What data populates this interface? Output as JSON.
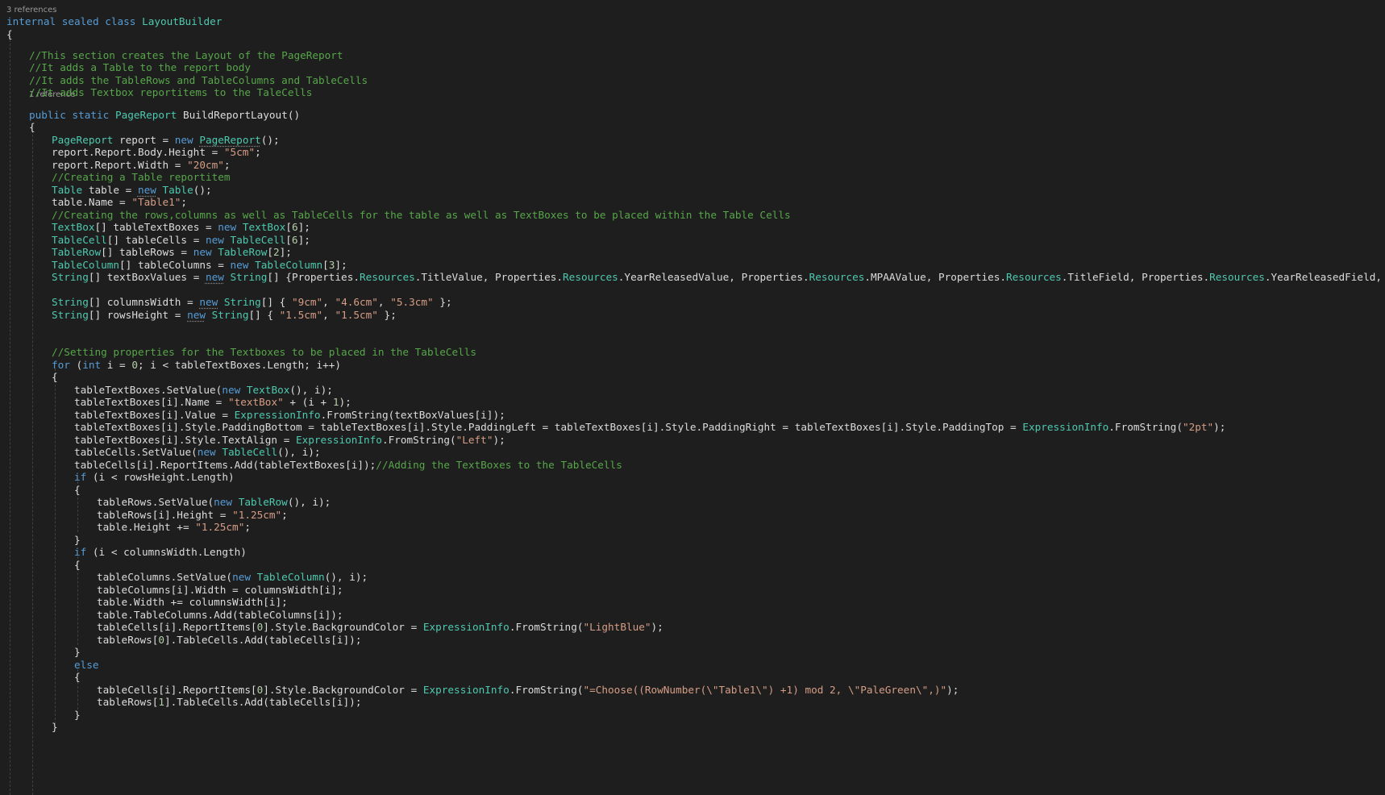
{
  "editor": {
    "codelens": {
      "class_refs": "3 references",
      "method_refs": "1 reference"
    },
    "lines": [
      [
        [
          "kw",
          "internal sealed class "
        ],
        [
          "ty",
          "LayoutBuilder"
        ]
      ],
      [
        [
          "pl",
          "{"
        ]
      ],
      [
        [
          "cm",
          "//This section creates the Layout of the PageReport"
        ]
      ],
      [
        [
          "cm",
          "//It adds a Table to the report body"
        ]
      ],
      [
        [
          "cm",
          "//It adds the TableRows and TableColumns and TableCells"
        ]
      ],
      [
        [
          "cm",
          "//It adds Textbox reportitems to the TaleCells"
        ]
      ],
      [
        [
          "kw",
          "public static "
        ],
        [
          "ty",
          "PageReport"
        ],
        [
          "pl",
          " BuildReportLayout()"
        ]
      ],
      [
        [
          "pl",
          "{"
        ]
      ],
      [
        [
          "ty",
          "PageReport"
        ],
        [
          "pl",
          " report = "
        ],
        [
          "kw",
          "new "
        ],
        [
          "tysq",
          "PageReport"
        ],
        [
          "pl",
          "();"
        ]
      ],
      [
        [
          "pl",
          "report.Report.Body.Height = "
        ],
        [
          "st",
          "\"5cm\""
        ],
        [
          "pl",
          ";"
        ]
      ],
      [
        [
          "pl",
          "report.Report.Width = "
        ],
        [
          "st",
          "\"20cm\""
        ],
        [
          "pl",
          ";"
        ]
      ],
      [
        [
          "cm",
          "//Creating a Table reportitem"
        ]
      ],
      [
        [
          "ty",
          "Table"
        ],
        [
          "pl",
          " table = "
        ],
        [
          "kwsq",
          "new"
        ],
        [
          "pl",
          " "
        ],
        [
          "ty",
          "Table"
        ],
        [
          "pl",
          "();"
        ]
      ],
      [
        [
          "pl",
          "table.Name = "
        ],
        [
          "st",
          "\"Table1\""
        ],
        [
          "pl",
          ";"
        ]
      ],
      [
        [
          "cm",
          "//Creating the rows,columns as well as TableCells for the table as well as TextBoxes to be placed within the Table Cells"
        ]
      ],
      [
        [
          "ty",
          "TextBox"
        ],
        [
          "pl",
          "[] tableTextBoxes = "
        ],
        [
          "kw",
          "new "
        ],
        [
          "ty",
          "TextBox"
        ],
        [
          "pl",
          "["
        ],
        [
          "nu",
          "6"
        ],
        [
          "pl",
          "];"
        ]
      ],
      [
        [
          "ty",
          "TableCell"
        ],
        [
          "pl",
          "[] tableCells = "
        ],
        [
          "kw",
          "new "
        ],
        [
          "ty",
          "TableCell"
        ],
        [
          "pl",
          "["
        ],
        [
          "nu",
          "6"
        ],
        [
          "pl",
          "];"
        ]
      ],
      [
        [
          "ty",
          "TableRow"
        ],
        [
          "pl",
          "[] tableRows = "
        ],
        [
          "kw",
          "new "
        ],
        [
          "ty",
          "TableRow"
        ],
        [
          "pl",
          "["
        ],
        [
          "nu",
          "2"
        ],
        [
          "pl",
          "];"
        ]
      ],
      [
        [
          "ty",
          "TableColumn"
        ],
        [
          "pl",
          "[] tableColumns = "
        ],
        [
          "kw",
          "new "
        ],
        [
          "ty",
          "TableColumn"
        ],
        [
          "pl",
          "["
        ],
        [
          "nu",
          "3"
        ],
        [
          "pl",
          "];"
        ]
      ],
      [
        [
          "ty",
          "String"
        ],
        [
          "pl",
          "[] textBoxValues = "
        ],
        [
          "kwsq",
          "new"
        ],
        [
          "pl",
          " "
        ],
        [
          "ty",
          "String"
        ],
        [
          "pl",
          "[] {Properties."
        ],
        [
          "ty",
          "Resources"
        ],
        [
          "pl",
          ".TitleValue, Properties."
        ],
        [
          "ty",
          "Resources"
        ],
        [
          "pl",
          ".YearReleasedValue, Properties."
        ],
        [
          "ty",
          "Resources"
        ],
        [
          "pl",
          ".MPAAValue, Properties."
        ],
        [
          "ty",
          "Resources"
        ],
        [
          "pl",
          ".TitleField, Properties."
        ],
        [
          "ty",
          "Resources"
        ],
        [
          "pl",
          ".YearReleasedField,"
        ]
      ],
      [],
      [
        [
          "ty",
          "String"
        ],
        [
          "pl",
          "[] columnsWidth = "
        ],
        [
          "kwsq",
          "new"
        ],
        [
          "pl",
          " "
        ],
        [
          "ty",
          "String"
        ],
        [
          "pl",
          "[] { "
        ],
        [
          "st",
          "\"9cm\""
        ],
        [
          "pl",
          ", "
        ],
        [
          "st",
          "\"4.6cm\""
        ],
        [
          "pl",
          ", "
        ],
        [
          "st",
          "\"5.3cm\""
        ],
        [
          "pl",
          " };"
        ]
      ],
      [
        [
          "ty",
          "String"
        ],
        [
          "pl",
          "[] rowsHeight = "
        ],
        [
          "kwsq",
          "new"
        ],
        [
          "pl",
          " "
        ],
        [
          "ty",
          "String"
        ],
        [
          "pl",
          "[] { "
        ],
        [
          "st",
          "\"1.5cm\""
        ],
        [
          "pl",
          ", "
        ],
        [
          "st",
          "\"1.5cm\""
        ],
        [
          "pl",
          " };"
        ]
      ],
      [],
      [],
      [
        [
          "cm",
          "//Setting properties for the Textboxes to be placed in the TableCells"
        ]
      ],
      [
        [
          "kw",
          "for"
        ],
        [
          "pl",
          " ("
        ],
        [
          "kw",
          "int"
        ],
        [
          "pl",
          " i = "
        ],
        [
          "nu",
          "0"
        ],
        [
          "pl",
          "; i < tableTextBoxes.Length; i++)"
        ]
      ],
      [
        [
          "pl",
          "{"
        ]
      ],
      [
        [
          "pl",
          "tableTextBoxes.SetValue("
        ],
        [
          "kw",
          "new "
        ],
        [
          "ty",
          "TextBox"
        ],
        [
          "pl",
          "(), i);"
        ]
      ],
      [
        [
          "pl",
          "tableTextBoxes[i].Name = "
        ],
        [
          "st",
          "\"textBox\""
        ],
        [
          "pl",
          " + (i + "
        ],
        [
          "nu",
          "1"
        ],
        [
          "pl",
          ");"
        ]
      ],
      [
        [
          "pl",
          "tableTextBoxes[i].Value = "
        ],
        [
          "ty",
          "ExpressionInfo"
        ],
        [
          "pl",
          ".FromString(textBoxValues[i]);"
        ]
      ],
      [
        [
          "pl",
          "tableTextBoxes[i].Style.PaddingBottom = tableTextBoxes[i].Style.PaddingLeft = tableTextBoxes[i].Style.PaddingRight = tableTextBoxes[i].Style.PaddingTop = "
        ],
        [
          "ty",
          "ExpressionInfo"
        ],
        [
          "pl",
          ".FromString("
        ],
        [
          "st",
          "\"2pt\""
        ],
        [
          "pl",
          ");"
        ]
      ],
      [
        [
          "pl",
          "tableTextBoxes[i].Style.TextAlign = "
        ],
        [
          "ty",
          "ExpressionInfo"
        ],
        [
          "pl",
          ".FromString("
        ],
        [
          "st",
          "\"Left\""
        ],
        [
          "pl",
          ");"
        ]
      ],
      [
        [
          "pl",
          "tableCells.SetValue("
        ],
        [
          "kw",
          "new "
        ],
        [
          "ty",
          "TableCell"
        ],
        [
          "pl",
          "(), i);"
        ]
      ],
      [
        [
          "pl",
          "tableCells[i].ReportItems.Add(tableTextBoxes[i]);"
        ],
        [
          "cm",
          "//Adding the TextBoxes to the TableCells"
        ]
      ],
      [
        [
          "kw",
          "if"
        ],
        [
          "pl",
          " (i < rowsHeight.Length)"
        ]
      ],
      [
        [
          "pl",
          "{"
        ]
      ],
      [
        [
          "pl",
          "tableRows.SetValue("
        ],
        [
          "kw",
          "new "
        ],
        [
          "ty",
          "TableRow"
        ],
        [
          "pl",
          "(), i);"
        ]
      ],
      [
        [
          "pl",
          "tableRows[i].Height = "
        ],
        [
          "st",
          "\"1.25cm\""
        ],
        [
          "pl",
          ";"
        ]
      ],
      [
        [
          "pl",
          "table.Height += "
        ],
        [
          "st",
          "\"1.25cm\""
        ],
        [
          "pl",
          ";"
        ]
      ],
      [
        [
          "pl",
          "}"
        ]
      ],
      [
        [
          "kw",
          "if"
        ],
        [
          "pl",
          " (i < columnsWidth.Length)"
        ]
      ],
      [
        [
          "pl",
          "{"
        ]
      ],
      [
        [
          "pl",
          "tableColumns.SetValue("
        ],
        [
          "kw",
          "new "
        ],
        [
          "ty",
          "TableColumn"
        ],
        [
          "pl",
          "(), i);"
        ]
      ],
      [
        [
          "pl",
          "tableColumns[i].Width = columnsWidth[i];"
        ]
      ],
      [
        [
          "pl",
          "table.Width += columnsWidth[i];"
        ]
      ],
      [
        [
          "pl",
          "table.TableColumns.Add(tableColumns[i]);"
        ]
      ],
      [
        [
          "pl",
          "tableCells[i].ReportItems["
        ],
        [
          "nu",
          "0"
        ],
        [
          "pl",
          "].Style.BackgroundColor = "
        ],
        [
          "ty",
          "ExpressionInfo"
        ],
        [
          "pl",
          ".FromString("
        ],
        [
          "st",
          "\"LightBlue\""
        ],
        [
          "pl",
          ");"
        ]
      ],
      [
        [
          "pl",
          "tableRows["
        ],
        [
          "nu",
          "0"
        ],
        [
          "pl",
          "].TableCells.Add(tableCells[i]);"
        ]
      ],
      [
        [
          "pl",
          "}"
        ]
      ],
      [
        [
          "kw",
          "else"
        ]
      ],
      [
        [
          "pl",
          "{"
        ]
      ],
      [
        [
          "pl",
          "tableCells[i].ReportItems["
        ],
        [
          "nu",
          "0"
        ],
        [
          "pl",
          "].Style.BackgroundColor = "
        ],
        [
          "ty",
          "ExpressionInfo"
        ],
        [
          "pl",
          ".FromString("
        ],
        [
          "st",
          "\"=Choose((RowNumber(\\\"Table1\\\") +1) mod 2, \\\"PaleGreen\\\",)\""
        ],
        [
          "pl",
          ");"
        ]
      ],
      [
        [
          "pl",
          "tableRows["
        ],
        [
          "nu",
          "1"
        ],
        [
          "pl",
          "].TableCells.Add(tableCells[i]);"
        ]
      ],
      [
        [
          "pl",
          "}"
        ]
      ],
      [
        [
          "pl",
          "}"
        ]
      ]
    ]
  }
}
